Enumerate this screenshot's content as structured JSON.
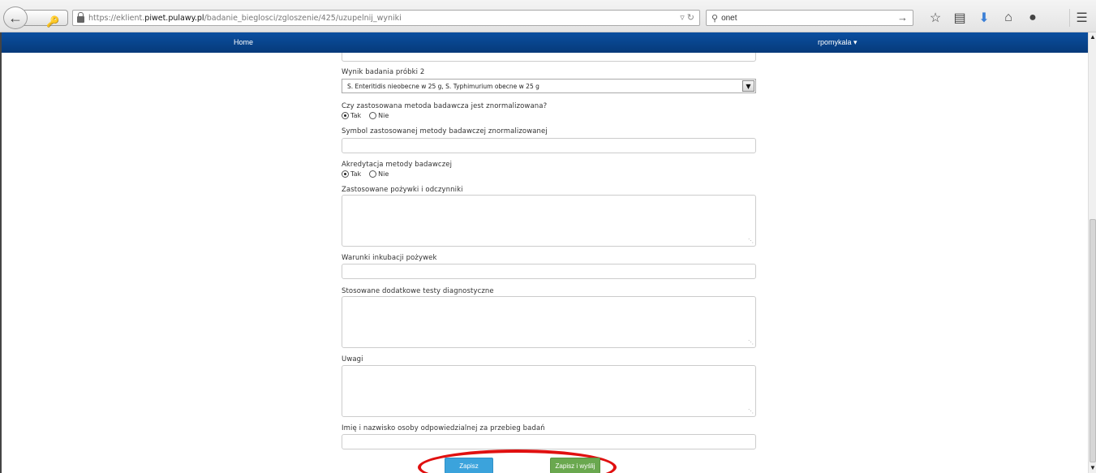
{
  "browser": {
    "url_prefix": "https://eklient.",
    "url_domain": "piwet.pulawy.pl",
    "url_path": "/badanie_bieglosci/zgloszenie/425/uzupelnij_wyniki",
    "search_value": "onet"
  },
  "nav": {
    "home_label": "Home",
    "user_label": "rpomykala ▾"
  },
  "form": {
    "sample2_label": "Wynik badania próbki 2",
    "sample2_value": "S. Enteritidis nieobecne w 25 g, S. Typhimurium obecne w 25 g",
    "normalized_label": "Czy zastosowana metoda badawcza jest znormalizowana?",
    "normalized_yes": "Tak",
    "normalized_no": "Nie",
    "symbol_label": "Symbol zastosowanej metody badawczej znormalizowanej",
    "accreditation_label": "Akredytacja metody badawczej",
    "accreditation_yes": "Tak",
    "accreditation_no": "Nie",
    "media_label": "Zastosowane pożywki i odczynniki",
    "incubation_label": "Warunki inkubacji pożywek",
    "tests_label": "Stosowane dodatkowe testy diagnostyczne",
    "notes_label": "Uwagi",
    "responsible_label": "Imię i nazwisko osoby odpowiedzialnej za przebieg badań",
    "save_label": "Zapisz",
    "save_send_label": "Zapisz i wyślij"
  },
  "colors": {
    "nav_bg": "#0b4fa0",
    "save_btn": "#3ba3dc",
    "send_btn": "#6aa84f",
    "highlight": "#e01010"
  }
}
